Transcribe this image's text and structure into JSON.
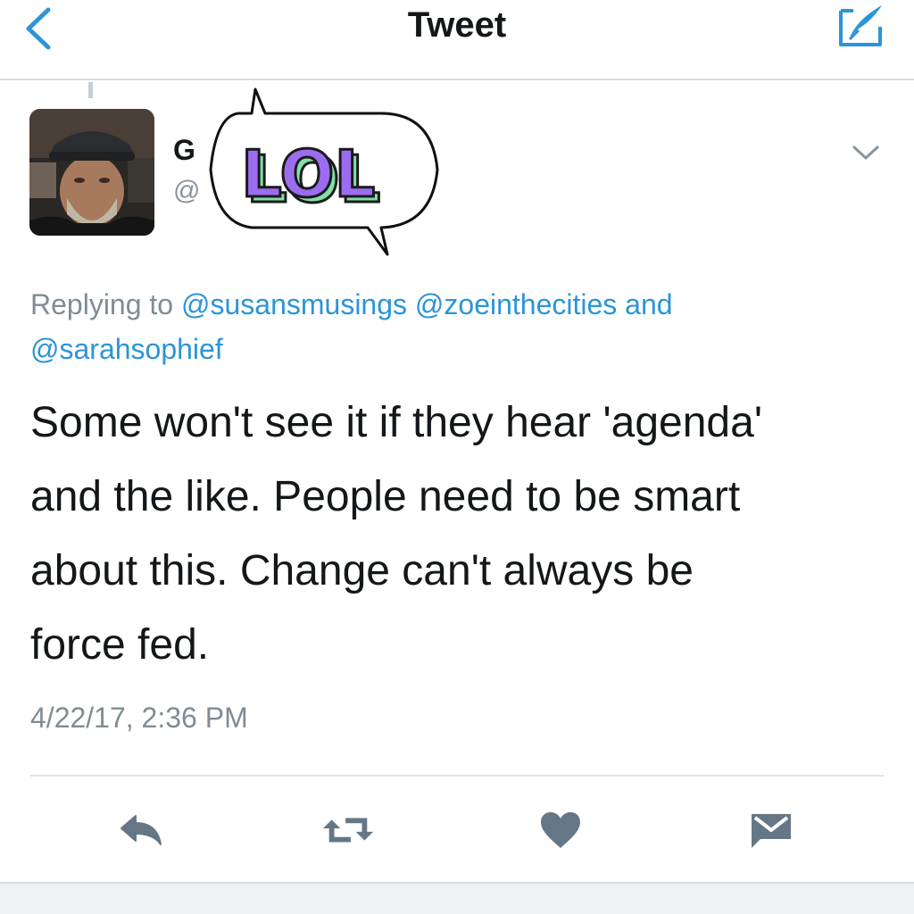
{
  "navbar": {
    "title": "Tweet",
    "back_icon": "chevron-left-icon",
    "compose_icon": "compose-icon",
    "accent": "#2b95d8"
  },
  "tweet": {
    "display_name": "G",
    "handle": "@",
    "sticker_text": "LOL",
    "replying_prefix": "Replying to",
    "mentions": [
      "@susansmusings",
      "@zoeinthecities"
    ],
    "mentions_and": "and",
    "mention_last": "@sarahsophief",
    "text_lines": [
      "Some won't see it if they hear 'agenda'",
      "and the like. People need to be smart",
      "about this. Change can't always be",
      "force fed."
    ],
    "timestamp": "4/22/17, 2:36 PM"
  },
  "actions": [
    {
      "name": "reply",
      "icon": "reply-icon"
    },
    {
      "name": "retweet",
      "icon": "retweet-icon"
    },
    {
      "name": "like",
      "icon": "heart-icon"
    },
    {
      "name": "message",
      "icon": "envelope-icon"
    }
  ],
  "colors": {
    "link": "#2b95d8",
    "muted": "#7f8c96",
    "icon": "#657786",
    "sticker_purple": "#9b6cf0",
    "sticker_green": "#7fe0a8"
  }
}
